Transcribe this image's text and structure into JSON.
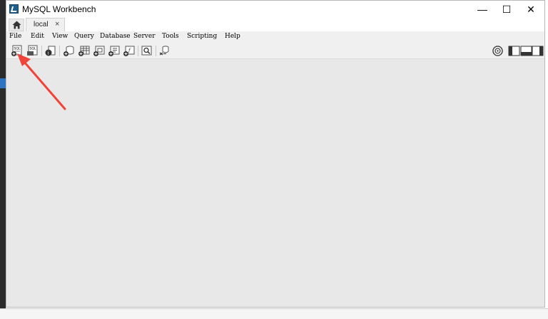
{
  "window": {
    "title": "MySQL Workbench",
    "minimize_glyph": "—",
    "maximize_glyph": "☐",
    "close_glyph": "✕"
  },
  "tabs": {
    "home_icon": "home-icon",
    "connection_tab_label": "local",
    "connection_tab_close": "×"
  },
  "menu": [
    "File",
    "Edit",
    "View",
    "Query",
    "Database",
    "Server",
    "Tools",
    "Scripting",
    "Help"
  ],
  "toolbar": {
    "buttons": [
      {
        "name": "new-sql-tab-icon",
        "label": "SQL"
      },
      {
        "name": "open-sql-script-icon",
        "label": "SQL"
      },
      {
        "name": "inspector-icon"
      },
      {
        "name": "create-schema-icon"
      },
      {
        "name": "create-table-icon"
      },
      {
        "name": "create-view-icon"
      },
      {
        "name": "create-procedure-icon"
      },
      {
        "name": "create-function-icon"
      },
      {
        "name": "search-table-data-icon"
      },
      {
        "name": "reconnect-icon"
      }
    ],
    "right_buttons": [
      {
        "name": "settings-icon"
      },
      {
        "name": "toggle-sidebar-icon"
      },
      {
        "name": "toggle-output-icon"
      },
      {
        "name": "toggle-secondary-sidebar-icon"
      }
    ]
  },
  "colors": {
    "annotation_arrow": "#f0443a",
    "content_background": "#e8e8e8",
    "toolbar_background": "#f0f0f0"
  }
}
